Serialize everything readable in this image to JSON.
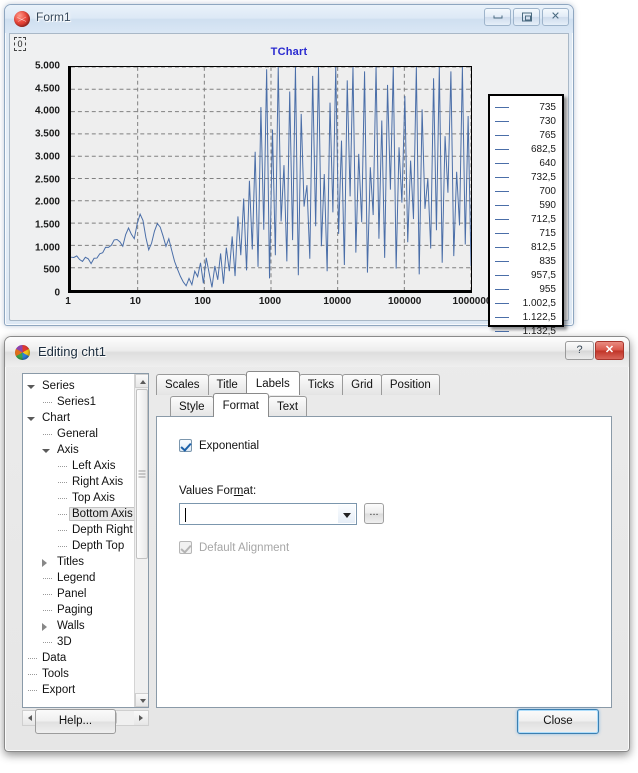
{
  "form_window": {
    "title": "Form1",
    "icon": "globe-icon",
    "buttons": {
      "minimize": "minimize-icon",
      "maximize": "maximize-icon",
      "close": "close-icon"
    }
  },
  "chart": {
    "title": "TChart",
    "series_name": "Series1",
    "line_color": "#4a6ea8",
    "panel_color": "#eeeeee",
    "y_labels": [
      "5.000",
      "4.500",
      "4.000",
      "3.500",
      "3.000",
      "2.500",
      "2.000",
      "1.500",
      "1.000",
      "500",
      "0"
    ],
    "x_labels": [
      "1",
      "10",
      "100",
      "1000",
      "10000",
      "100000",
      "1000000"
    ],
    "legend": [
      "735",
      "730",
      "765",
      "682,5",
      "640",
      "732,5",
      "700",
      "590",
      "712,5",
      "715",
      "812,5",
      "835",
      "957,5",
      "955",
      "1.002,5",
      "1.122,5",
      "1.132,5"
    ]
  },
  "chart_data": {
    "type": "line",
    "title": "TChart",
    "xlabel": "",
    "ylabel": "",
    "xscale": "log",
    "xlim": [
      1,
      1000000
    ],
    "ylim": [
      0,
      5000
    ],
    "yticks": [
      0,
      500,
      1000,
      1500,
      2000,
      2500,
      3000,
      3500,
      4000,
      4500,
      5000
    ],
    "ytick_labels": [
      "0",
      "500",
      "1.000",
      "1.500",
      "2.000",
      "2.500",
      "3.000",
      "3.500",
      "4.000",
      "4.500",
      "5.000"
    ],
    "xticks": [
      1,
      10,
      100,
      1000,
      10000,
      100000,
      1000000
    ],
    "xtick_labels": [
      "1",
      "10",
      "100",
      "1000",
      "10000",
      "100000",
      "1000000"
    ],
    "grid": true,
    "grid_style": "dashed",
    "legend_position": "right",
    "legend_entries": [
      "735",
      "730",
      "765",
      "682,5",
      "640",
      "732,5",
      "700",
      "590",
      "712,5",
      "715",
      "812,5",
      "835",
      "957,5",
      "955",
      "1.002,5",
      "1.122,5",
      "1.132,5"
    ],
    "series": [
      {
        "name": "Series1",
        "color": "#4a6ea8",
        "description": "Noisy signal on a logarithmic x-axis: flat around 700-750 from x=1 to x=30, dipping near 550 around x=60, rising to a broad hump peaking near 1.700 around x=300-600, falling to near 0 from x=700-1500, then becoming increasingly volatile with spikes reaching the 5.000 ceiling beyond x=10000.",
        "values": [
          735,
          730,
          765,
          682.5,
          640,
          732.5,
          700,
          590,
          712.5,
          715,
          812.5,
          835,
          957.5,
          955,
          1002.5,
          1122.5,
          1132.5,
          1080,
          980,
          1240,
          1390,
          1250,
          1150,
          1480,
          1700,
          1560,
          1180,
          900,
          1050,
          1320,
          1490,
          1410,
          1210,
          980,
          1150,
          890,
          640,
          470,
          310,
          180,
          95,
          260,
          120,
          420,
          300,
          610,
          150,
          720,
          380,
          60,
          540,
          230,
          820,
          140,
          950,
          420,
          1200,
          310,
          1650,
          780,
          2050,
          440,
          2450,
          910,
          3100,
          520,
          4100,
          1350,
          4950,
          260,
          3600,
          780,
          5000,
          1540,
          2800,
          640,
          4450,
          1120,
          5000,
          330,
          3950,
          1870,
          2350,
          700,
          4800,
          1430,
          5000,
          980,
          2600,
          420,
          4200,
          1740,
          5000,
          1260,
          3350,
          560,
          4700,
          2100,
          5000,
          840,
          3050,
          1520,
          4900,
          390,
          2750,
          1680,
          5000,
          1150,
          3800,
          720,
          4600,
          2250,
          5000,
          480,
          3200,
          1960,
          4350,
          1070,
          2900,
          1590,
          5000,
          350,
          4050,
          1820,
          2500,
          930,
          4750,
          1340,
          5000,
          610,
          3450,
          2180,
          4900,
          760,
          2650,
          1450,
          5000,
          1020,
          3900,
          540
        ]
      }
    ]
  },
  "dialog": {
    "title": "Editing cht1",
    "icon": "color-wheel-icon",
    "titlebar_buttons": {
      "help": "?",
      "close": "✕"
    },
    "tree": [
      {
        "label": "Series",
        "indent": 0,
        "expander": "open",
        "selected": false
      },
      {
        "label": "Series1",
        "indent": 1,
        "expander": "none",
        "selected": false
      },
      {
        "label": "Chart",
        "indent": 0,
        "expander": "open",
        "selected": false
      },
      {
        "label": "General",
        "indent": 1,
        "expander": "none",
        "selected": false
      },
      {
        "label": "Axis",
        "indent": 1,
        "expander": "open",
        "selected": false
      },
      {
        "label": "Left Axis",
        "indent": 2,
        "expander": "none",
        "selected": false
      },
      {
        "label": "Right Axis",
        "indent": 2,
        "expander": "none",
        "selected": false
      },
      {
        "label": "Top Axis",
        "indent": 2,
        "expander": "none",
        "selected": false
      },
      {
        "label": "Bottom Axis",
        "indent": 2,
        "expander": "none",
        "selected": true
      },
      {
        "label": "Depth Right",
        "indent": 2,
        "expander": "none",
        "selected": false
      },
      {
        "label": "Depth Top",
        "indent": 2,
        "expander": "none",
        "selected": false
      },
      {
        "label": "Titles",
        "indent": 1,
        "expander": "closed",
        "selected": false
      },
      {
        "label": "Legend",
        "indent": 1,
        "expander": "none",
        "selected": false
      },
      {
        "label": "Panel",
        "indent": 1,
        "expander": "none",
        "selected": false
      },
      {
        "label": "Paging",
        "indent": 1,
        "expander": "none",
        "selected": false
      },
      {
        "label": "Walls",
        "indent": 1,
        "expander": "closed",
        "selected": false
      },
      {
        "label": "3D",
        "indent": 1,
        "expander": "none",
        "selected": false
      },
      {
        "label": "Data",
        "indent": 0,
        "expander": "none",
        "selected": false
      },
      {
        "label": "Tools",
        "indent": 0,
        "expander": "none",
        "selected": false
      },
      {
        "label": "Export",
        "indent": 0,
        "expander": "none",
        "selected": false
      }
    ],
    "tabs_primary": [
      {
        "label": "Scales",
        "active": false
      },
      {
        "label": "Title",
        "active": false
      },
      {
        "label": "Labels",
        "active": true
      },
      {
        "label": "Ticks",
        "active": false
      },
      {
        "label": "Grid",
        "active": false
      },
      {
        "label": "Position",
        "active": false
      }
    ],
    "tabs_secondary": [
      {
        "label": "Style",
        "active": false
      },
      {
        "label": "Format",
        "active": true
      },
      {
        "label": "Text",
        "active": false
      }
    ],
    "panel": {
      "exponential_label": "Exponential",
      "exponential_checked": true,
      "values_format_label": "Values Format:",
      "values_format_value": "",
      "values_format_placeholder": "",
      "ellipsis_label": "...",
      "default_alignment_label": "Default Alignment",
      "default_alignment_checked": true,
      "default_alignment_disabled": true
    },
    "footer": {
      "help_label": "Help...",
      "close_label": "Close"
    }
  }
}
